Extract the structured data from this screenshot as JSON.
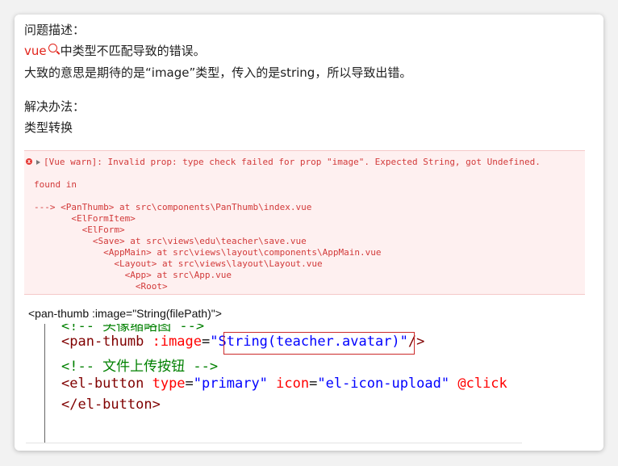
{
  "article": {
    "problem_heading": "问题描述：",
    "keyword_link": "vue",
    "problem_line1_rest": "中类型不匹配导致的错误。",
    "problem_line2": "大致的意思是期待的是“image”类型，传入的是string，所以导致出错。",
    "solution_heading": "解决办法：",
    "solution_text": "类型转换"
  },
  "console": {
    "warn_text": "[Vue warn]: Invalid prop: type check failed for prop \"image\". Expected String, got Undefined.",
    "found_in": "found in",
    "trace": [
      "---> <PanThumb> at src\\components\\PanThumb\\index.vue",
      "       <ElFormItem>",
      "         <ElForm>",
      "           <Save> at src\\views\\edu\\teacher\\save.vue",
      "             <AppMain> at src\\views\\layout\\components\\AppMain.vue",
      "               <Layout> at src\\views\\layout\\Layout.vue",
      "                 <App> at src\\App.vue",
      "                   <Root>"
    ]
  },
  "code_caption": "<pan-thumb  :image=\"String(filePath)\">",
  "editor": {
    "line0": "<!-- 头像缩略图 -->",
    "line1_tag": "<pan-thumb",
    "line1_attr": " :image",
    "line1_eq": "=",
    "line1_str": "\"String(teacher.avatar)\"",
    "line1_end": "/>",
    "line2_comment": "<!-- 文件上传按钮 -->",
    "line3_tag": "<el-button",
    "line3_attr1": " type",
    "line3_eq1": "=",
    "line3_str1": "\"primary\"",
    "line3_attr2": " icon",
    "line3_eq2": "=",
    "line3_str2": "\"el-icon-upload\"",
    "line3_attr3": " @click",
    "line4_tag": "</el-button>"
  }
}
